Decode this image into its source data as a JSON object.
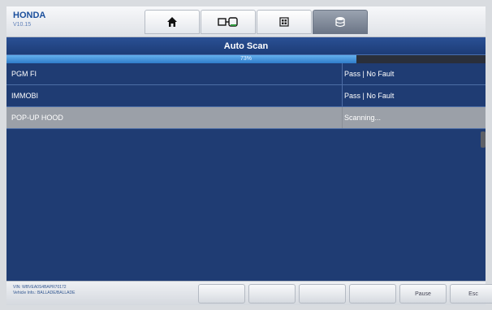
{
  "header": {
    "make": "HONDA",
    "version": "V10.15",
    "tabs": [
      {
        "icon": "home-icon",
        "active": false
      },
      {
        "icon": "vehicle-connector-icon",
        "active": false
      },
      {
        "icon": "grid-settings-icon",
        "active": false
      },
      {
        "icon": "database-icon",
        "active": true
      }
    ]
  },
  "main": {
    "title": "Auto Scan",
    "progress_percent": 73,
    "progress_label": "73%",
    "rows": [
      {
        "system": "PGM FI",
        "result": "Pass | No Fault",
        "selected": false
      },
      {
        "system": "IMMOBI",
        "result": "Pass | No Fault",
        "selected": false
      },
      {
        "system": "POP-UP HOOD",
        "result": "Scanning...",
        "selected": true
      }
    ]
  },
  "footer": {
    "vin_line": "VIN: WBVEA0S4BAPR70172",
    "vehicle_line": "Vehicle Info.: BALLADE/BALLADE",
    "buttons": [
      "",
      "",
      "",
      "",
      "Pause",
      "Esc"
    ]
  },
  "colors": {
    "panel": "#1f3c73",
    "selected_row": "#9ba0a8",
    "progress": "#3c8ad6"
  }
}
